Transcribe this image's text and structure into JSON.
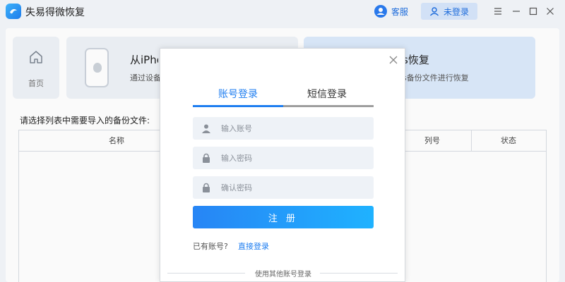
{
  "app": {
    "title": "失易得微恢复",
    "service_label": "客服",
    "login_label": "未登录"
  },
  "main": {
    "home_label": "首页",
    "card_device": {
      "title": "从iPhone",
      "desc": "通过设备"
    },
    "card_itunes": {
      "title": "s恢复",
      "desc": "s备份文件进行恢复"
    },
    "section_label": "请选择列表中需要导入的备份文件:",
    "table": {
      "columns": [
        "名称",
        "列号",
        "状态"
      ]
    }
  },
  "modal": {
    "tabs": [
      {
        "label": "账号登录",
        "active": true
      },
      {
        "label": "短信登录",
        "active": false
      }
    ],
    "fields": {
      "account_placeholder": "输入账号",
      "password_placeholder": "输入密码",
      "confirm_placeholder": "确认密码"
    },
    "register_label": "注 册",
    "have_account": "已有账号?",
    "direct_login": "直接登录",
    "other_login": "使用其他账号登录"
  },
  "colors": {
    "accent": "#1f7ef0",
    "tab_inactive_line": "#9e9e9e",
    "field_bg": "#eef2f7"
  }
}
